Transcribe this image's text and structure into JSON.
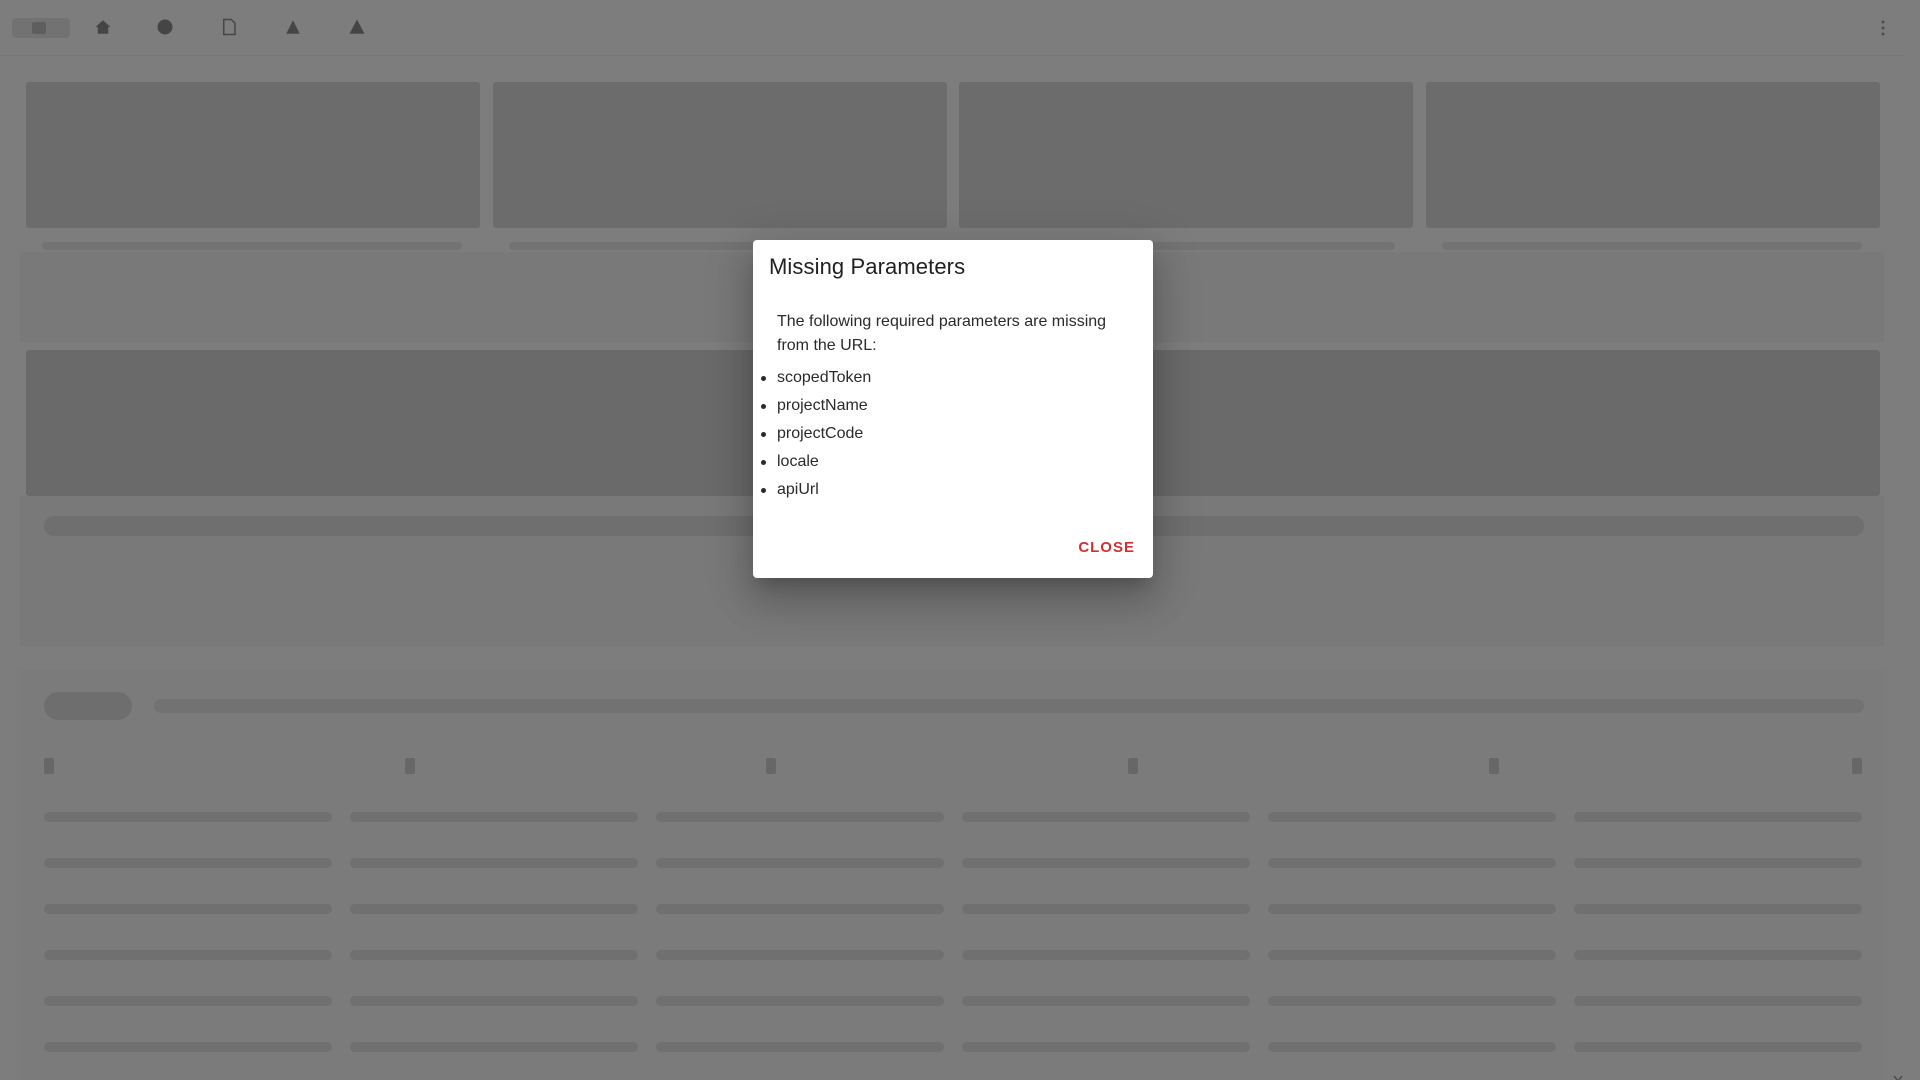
{
  "dialog": {
    "title": "Missing Parameters",
    "message": "The following required parameters are missing from the URL:",
    "params": [
      "scopedToken",
      "projectName",
      "projectCode",
      "locale",
      "apiUrl"
    ],
    "close_label": "CLOSE"
  },
  "topbar": {
    "icons": [
      "home-icon",
      "globe-icon",
      "document-icon",
      "person-icon",
      "warning-icon"
    ]
  },
  "colors": {
    "accent": "#d32f2f",
    "overlay": "rgba(0,0,0,0.5)"
  }
}
